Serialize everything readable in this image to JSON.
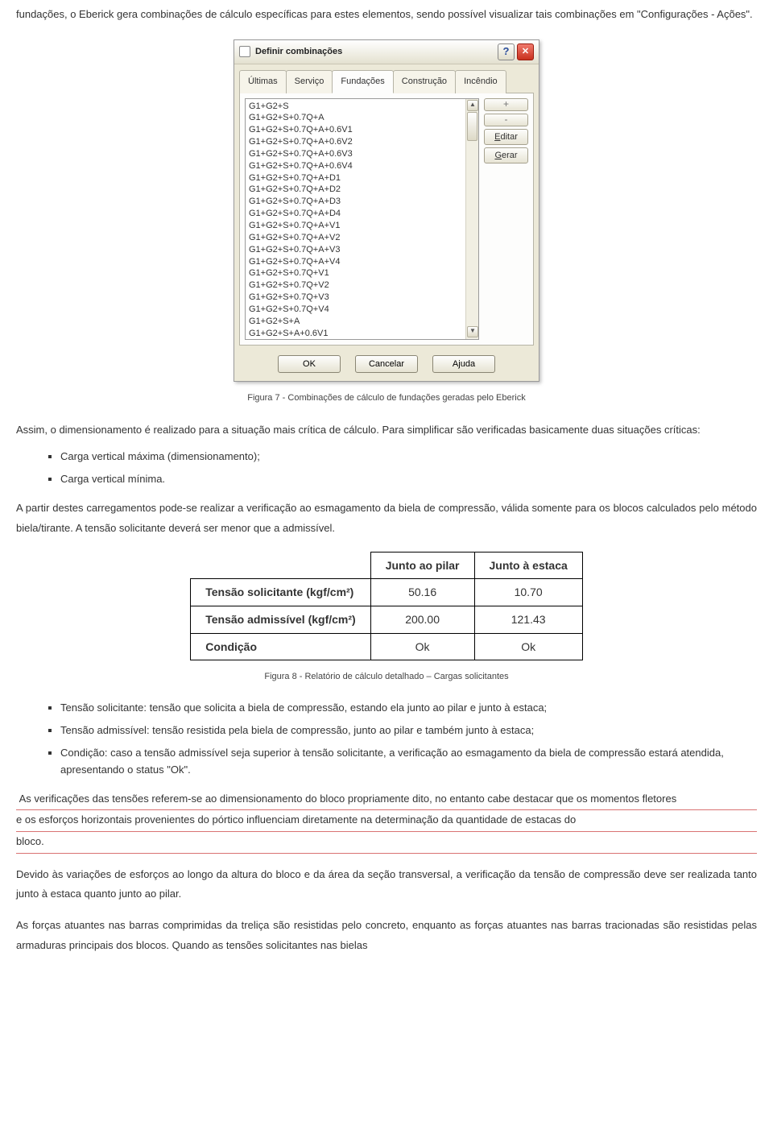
{
  "intro_paragraph": "fundações, o Eberick gera combinações de cálculo específicas para estes elementos, sendo possível visualizar tais combinações em \"Configurações - Ações\".",
  "dialog": {
    "title": "Definir combinações",
    "tabs": [
      "Últimas",
      "Serviço",
      "Fundações",
      "Construção",
      "Incêndio"
    ],
    "active_tab": 2,
    "list_items": [
      "G1+G2+S",
      "G1+G2+S+0.7Q+A",
      "G1+G2+S+0.7Q+A+0.6V1",
      "G1+G2+S+0.7Q+A+0.6V2",
      "G1+G2+S+0.7Q+A+0.6V3",
      "G1+G2+S+0.7Q+A+0.6V4",
      "G1+G2+S+0.7Q+A+D1",
      "G1+G2+S+0.7Q+A+D2",
      "G1+G2+S+0.7Q+A+D3",
      "G1+G2+S+0.7Q+A+D4",
      "G1+G2+S+0.7Q+A+V1",
      "G1+G2+S+0.7Q+A+V2",
      "G1+G2+S+0.7Q+A+V3",
      "G1+G2+S+0.7Q+A+V4",
      "G1+G2+S+0.7Q+V1",
      "G1+G2+S+0.7Q+V2",
      "G1+G2+S+0.7Q+V3",
      "G1+G2+S+0.7Q+V4",
      "G1+G2+S+A",
      "G1+G2+S+A+0.6V1"
    ],
    "side_buttons": {
      "plus": "+",
      "minus": "-",
      "edit": "Editar",
      "gen": "Gerar"
    },
    "bottom_buttons": {
      "ok": "OK",
      "cancel": "Cancelar",
      "help": "Ajuda"
    }
  },
  "fig7_caption": "Figura 7 - Combinações de cálculo de fundações geradas pelo Eberick",
  "para_after_fig7": "Assim, o dimensionamento é realizado para a situação mais crítica de cálculo. Para simplificar são verificadas basicamente duas situações críticas:",
  "bullets1": [
    "Carga vertical máxima (dimensionamento);",
    "Carga vertical mínima."
  ],
  "para_bielas": "A partir destes carregamentos pode-se realizar a verificação ao esmagamento da biela de compressão, válida somente para os blocos calculados pelo método biela/tirante. A tensão solicitante deverá ser menor que a admissível.",
  "res_table": {
    "headers": [
      "Junto ao pilar",
      "Junto à estaca"
    ],
    "rows": [
      {
        "label": "Tensão solicitante (kgf/cm²)",
        "vals": [
          "50.16",
          "10.70"
        ]
      },
      {
        "label": "Tensão admissível (kgf/cm²)",
        "vals": [
          "200.00",
          "121.43"
        ]
      },
      {
        "label": "Condição",
        "vals": [
          "Ok",
          "Ok"
        ]
      }
    ]
  },
  "fig8_caption": "Figura 8 - Relatório de cálculo detalhado – Cargas solicitantes",
  "bullets2": [
    "Tensão solicitante: tensão que solicita a biela de compressão, estando ela junto ao pilar e junto à estaca;",
    "Tensão admissível: tensão resistida pela biela de compressão, junto ao pilar e também junto à estaca;",
    "Condição: caso a tensão admissível seja superior à tensão solicitante, a verificação ao esmagamento da biela de compressão estará atendida, apresentando o status \"Ok\"."
  ],
  "highlighted": "As verificações das tensões referem-se ao dimensionamento do bloco propriamente dito, no entanto cabe destacar que os momentos fletores e os esforços horizontais provenientes do pórtico influenciam diretamente na determinação da quantidade de estacas do bloco.",
  "para_var": "Devido às variações de esforços ao longo da altura do bloco e da área da seção transversal, a verificação da tensão de compressão deve ser realizada tanto junto à estaca quanto junto ao pilar.",
  "para_forcas": "As forças  atuantes nas barras comprimidas da treliça são resistidas pelo concreto, enquanto as forças atuantes nas barras tracionadas são resistidas pelas armaduras principais dos blocos. Quando as tensões solicitantes nas bielas"
}
